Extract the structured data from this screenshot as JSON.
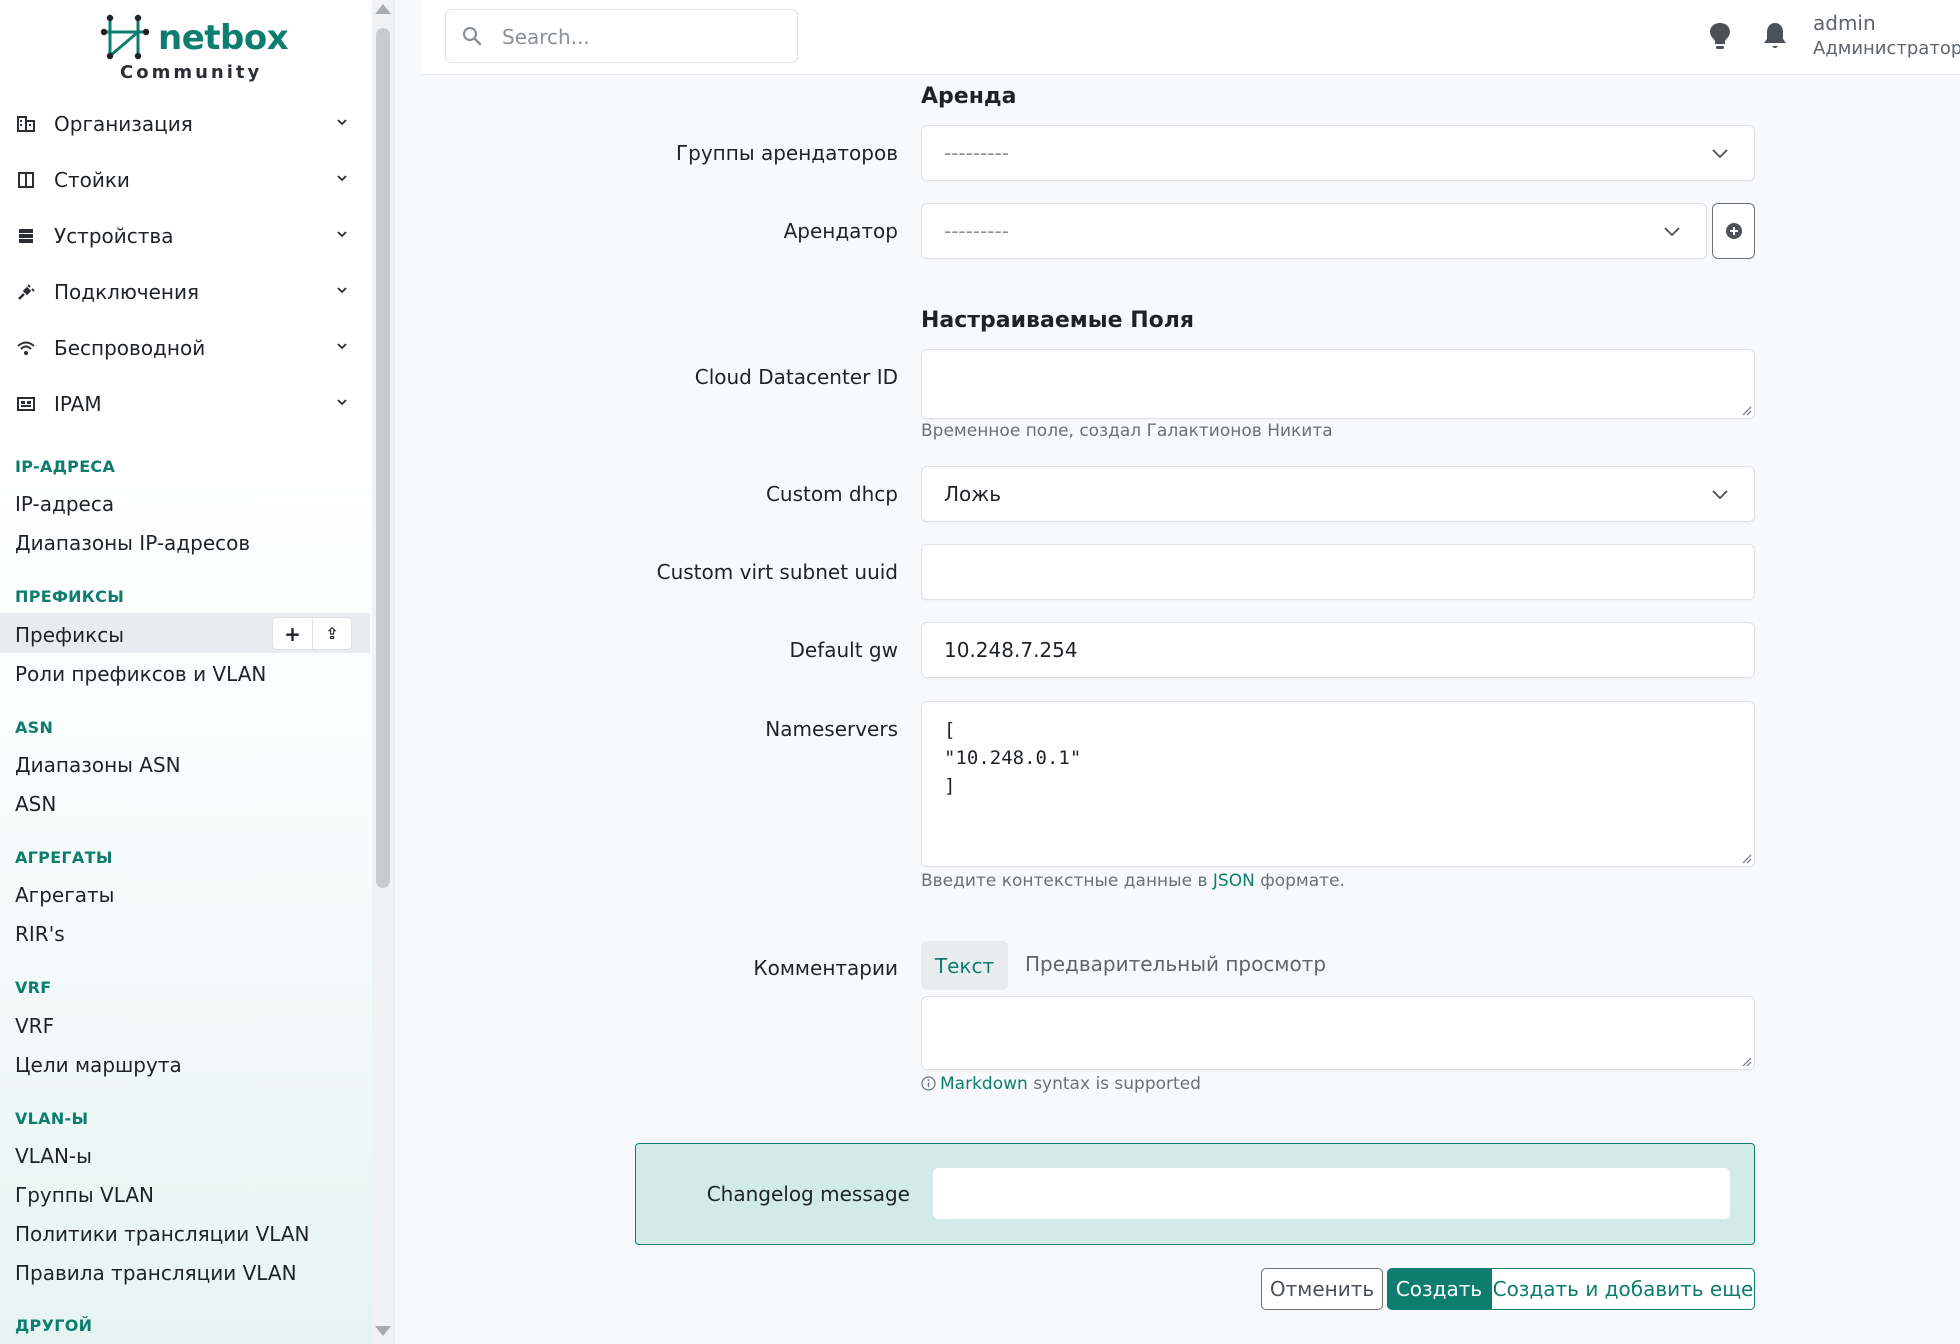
{
  "brand": {
    "name": "netbox",
    "edition": "Community",
    "accent_color": "#0c7d6e"
  },
  "header": {
    "search_placeholder": "Search...",
    "icons": [
      "lightbulb-icon",
      "bell-icon"
    ],
    "user": {
      "name": "admin",
      "role": "Администратор"
    }
  },
  "sidebar": {
    "menu": [
      {
        "label": "Организация",
        "icon": "building-icon"
      },
      {
        "label": "Стойки",
        "icon": "rack-icon"
      },
      {
        "label": "Устройства",
        "icon": "server-icon"
      },
      {
        "label": "Подключения",
        "icon": "plug-icon"
      },
      {
        "label": "Беспроводной",
        "icon": "wifi-icon"
      },
      {
        "label": "IPAM",
        "icon": "ipam-icon"
      }
    ],
    "sections": [
      {
        "title": "IP-АДРЕСА",
        "links": [
          "IP-адреса",
          "Диапазоны IP-адресов"
        ]
      },
      {
        "title": "ПРЕФИКСЫ",
        "links": [
          "Префиксы",
          "Роли префиксов и VLAN"
        ]
      },
      {
        "title": "ASN",
        "links": [
          "Диапазоны ASN",
          "ASN"
        ]
      },
      {
        "title": "АГРЕГАТЫ",
        "links": [
          "Агрегаты",
          "RIR's"
        ]
      },
      {
        "title": "VRF",
        "links": [
          "VRF",
          "Цели маршрута"
        ]
      },
      {
        "title": "VLAN-Ы",
        "links": [
          "VLAN-ы",
          "Группы VLAN",
          "Политики трансляции VLAN",
          "Правила трансляции VLAN"
        ]
      },
      {
        "title": "ДРУГОЙ",
        "links": []
      }
    ],
    "active_link": "Префиксы",
    "active_actions": {
      "add": "+",
      "import": "⇪"
    }
  },
  "form": {
    "tenancy": {
      "heading": "Аренда",
      "tenant_group_label": "Группы арендаторов",
      "tenant_group_value": "---------",
      "tenant_label": "Арендатор",
      "tenant_value": "---------"
    },
    "custom_fields": {
      "heading": "Настраиваемые Поля",
      "cloud_dc_label": "Cloud Datacenter ID",
      "cloud_dc_value": "",
      "cloud_dc_hint": "Временное поле, создал Галактионов Никита",
      "custom_dhcp_label": "Custom dhcp",
      "custom_dhcp_value": "Ложь",
      "virt_subnet_label": "Custom virt subnet uuid",
      "virt_subnet_value": "",
      "default_gw_label": "Default gw",
      "default_gw_value": "10.248.7.254",
      "nameservers_label": "Nameservers",
      "nameservers_lines": [
        "[",
        "\"10.248.0.1\"",
        "]"
      ],
      "nameservers_hint_prefix": "Введите контекстные данные в",
      "nameservers_hint_link": "JSON",
      "nameservers_hint_suffix": "формате."
    },
    "comments": {
      "label": "Комментарии",
      "tab_text": "Текст",
      "tab_preview": "Предварительный просмотр",
      "value": "",
      "hint_link": "Markdown",
      "hint_suffix": "syntax is supported"
    },
    "changelog": {
      "label": "Changelog message",
      "value": ""
    },
    "actions": {
      "cancel": "Отменить",
      "create": "Создать",
      "create_and_add": "Создать и добавить еще"
    }
  }
}
